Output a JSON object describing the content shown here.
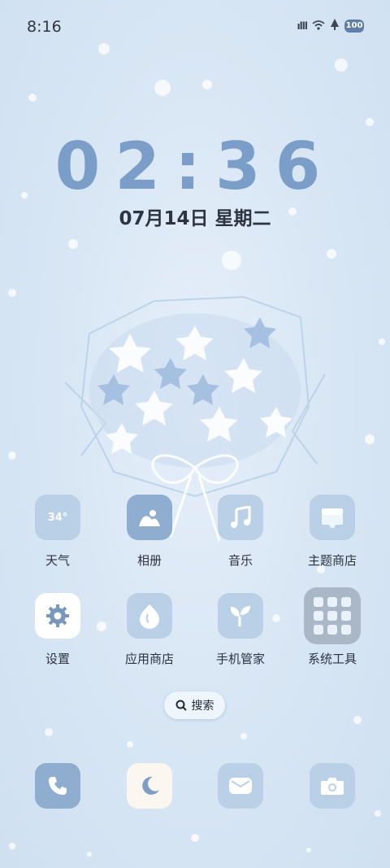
{
  "status_bar": {
    "time": "8:16",
    "signal_text": "ılll",
    "battery": "100"
  },
  "clock_widget": {
    "time": "02:36",
    "date": "07月14日 星期二"
  },
  "apps": [
    {
      "label": "天气",
      "icon": "weather-icon",
      "icon_text": "34°"
    },
    {
      "label": "相册",
      "icon": "gallery-icon"
    },
    {
      "label": "音乐",
      "icon": "music-icon"
    },
    {
      "label": "主题商店",
      "icon": "theme-store-icon"
    },
    {
      "label": "设置",
      "icon": "settings-gear-icon"
    },
    {
      "label": "应用商店",
      "icon": "app-store-icon"
    },
    {
      "label": "手机管家",
      "icon": "phone-manager-leaf-icon"
    },
    {
      "label": "系统工具",
      "icon": "folder-icon"
    }
  ],
  "search": {
    "label": "搜索"
  },
  "dock": [
    {
      "icon": "phone-icon"
    },
    {
      "icon": "moon-icon"
    },
    {
      "icon": "message-icon"
    },
    {
      "icon": "camera-icon"
    }
  ],
  "colors": {
    "accent": "#7b9ec8",
    "tile_light": "#b9d0e6",
    "tile_mid": "#8fadcf"
  }
}
